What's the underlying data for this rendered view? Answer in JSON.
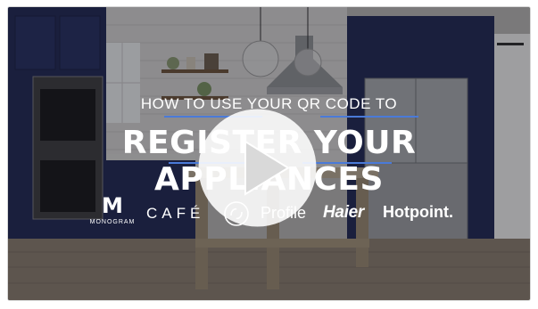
{
  "video": {
    "subtitle": "HOW TO USE YOUR QR CODE TO",
    "title": "REGISTER YOUR APPLIANCES",
    "play_icon": "play-icon"
  },
  "brands": {
    "monogram_mark": "M",
    "monogram_word": "MONOGRAM",
    "cafe": "CAFÉ",
    "ge_logo": "ge-logo",
    "profile": "Profile",
    "haier": "Haier",
    "hotpoint": "Hotpoint."
  },
  "colors": {
    "cabinet": "#1e2652",
    "accent_rule": "#4a7ad8",
    "text": "#ffffff"
  }
}
